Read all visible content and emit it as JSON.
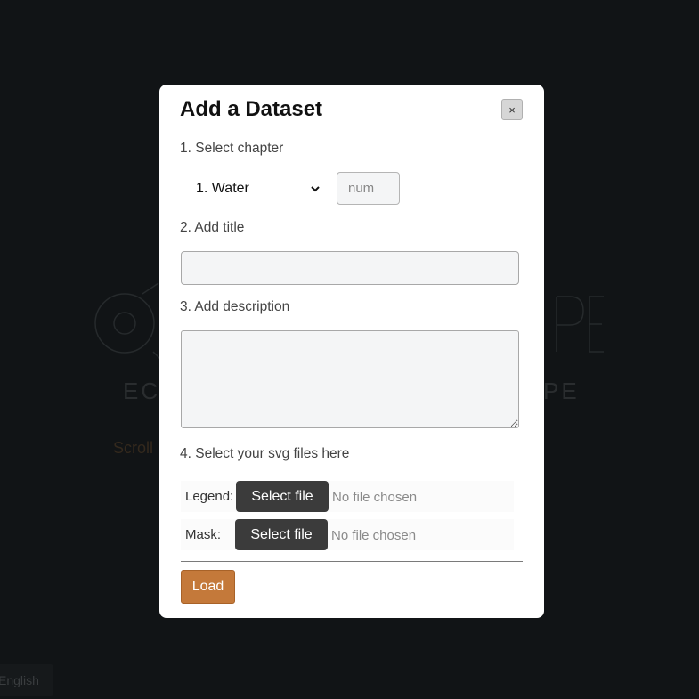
{
  "background": {
    "logo_text_left": "EC",
    "logo_text_right": "PE",
    "scroll_hint": "Scroll",
    "language_button": "English"
  },
  "modal": {
    "title": "Add a Dataset",
    "close_label": "×",
    "step1_label": "1. Select chapter",
    "chapter_selected": "1. Water",
    "chapter_number_placeholder": "num",
    "step2_label": "2. Add title",
    "title_value": "",
    "step3_label": "3. Add description",
    "description_value": "",
    "step4_label": "4. Select your svg files here",
    "legend_label": "Legend:",
    "mask_label": "Mask:",
    "select_file_label": "Select file",
    "no_file_text": "No file chosen",
    "load_label": "Load"
  },
  "colors": {
    "backdrop": "#111416",
    "load_button": "#c4793a",
    "file_button": "#3b3b3b"
  }
}
